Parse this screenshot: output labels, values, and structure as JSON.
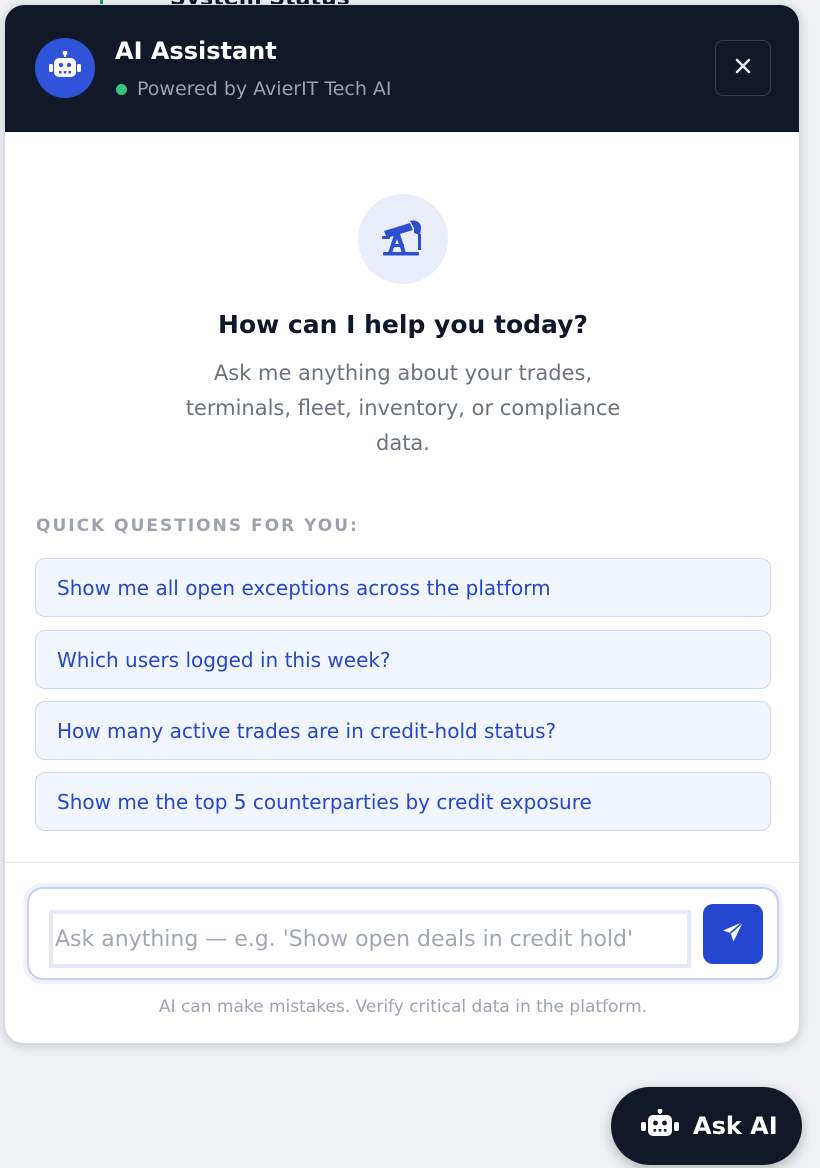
{
  "background": {
    "peek_text": "System Status"
  },
  "header": {
    "title": "AI Assistant",
    "subtitle": "Powered by AvierIT Tech AI",
    "status_color": "#34c77b",
    "avatar_icon": "robot-icon",
    "close_icon": "close-icon"
  },
  "hero": {
    "icon": "oil-pump-icon",
    "heading": "How can I help you today?",
    "description": "Ask me anything about your trades, terminals, fleet, inventory, or compliance data."
  },
  "quick_questions": {
    "label": "QUICK QUESTIONS FOR YOU:",
    "items": [
      "Show me all open exceptions across the platform",
      "Which users logged in this week?",
      "How many active trades are in credit-hold status?",
      "Show me the top 5 counterparties by credit exposure"
    ]
  },
  "composer": {
    "value": "",
    "placeholder": "Ask anything — e.g. 'Show open deals in credit hold'",
    "send_icon": "send-icon"
  },
  "disclaimer": "AI can make mistakes. Verify critical data in the platform.",
  "launcher": {
    "label": "Ask AI",
    "icon": "robot-icon"
  },
  "colors": {
    "accent": "#2547d0",
    "header_bg": "#111827",
    "question_text": "#2647c9"
  }
}
